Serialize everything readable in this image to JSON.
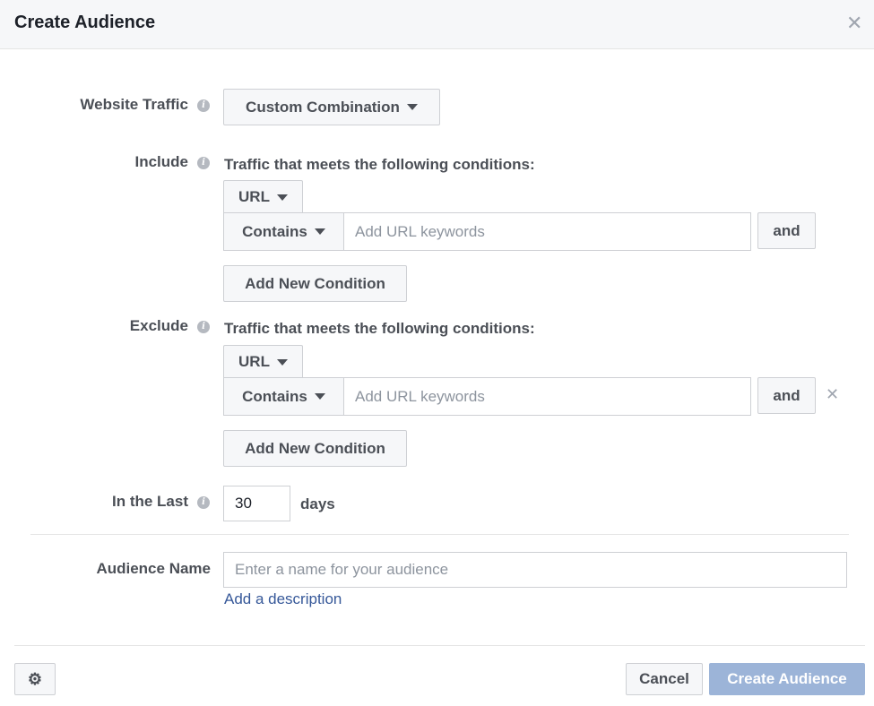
{
  "dialog": {
    "title": "Create Audience",
    "close_icon": "close-icon"
  },
  "website_traffic": {
    "label": "Website Traffic",
    "selected": "Custom Combination"
  },
  "include": {
    "label": "Include",
    "heading": "Traffic that meets the following conditions:",
    "field_select": "URL",
    "operator_select": "Contains",
    "keywords_placeholder": "Add URL keywords",
    "and_label": "and",
    "add_condition_label": "Add New Condition"
  },
  "exclude": {
    "label": "Exclude",
    "heading": "Traffic that meets the following conditions:",
    "field_select": "URL",
    "operator_select": "Contains",
    "keywords_placeholder": "Add URL keywords",
    "and_label": "and",
    "add_condition_label": "Add New Condition"
  },
  "retention": {
    "label": "In the Last",
    "value": "30",
    "unit": "days"
  },
  "audience_name": {
    "label": "Audience Name",
    "placeholder": "Enter a name for your audience",
    "add_description": "Add a description"
  },
  "footer": {
    "settings_icon": "gear-icon",
    "cancel_label": "Cancel",
    "create_label": "Create Audience"
  },
  "colors": {
    "primary_disabled": "#9cb4d8",
    "link": "#365899",
    "label": "#4b4f56"
  }
}
